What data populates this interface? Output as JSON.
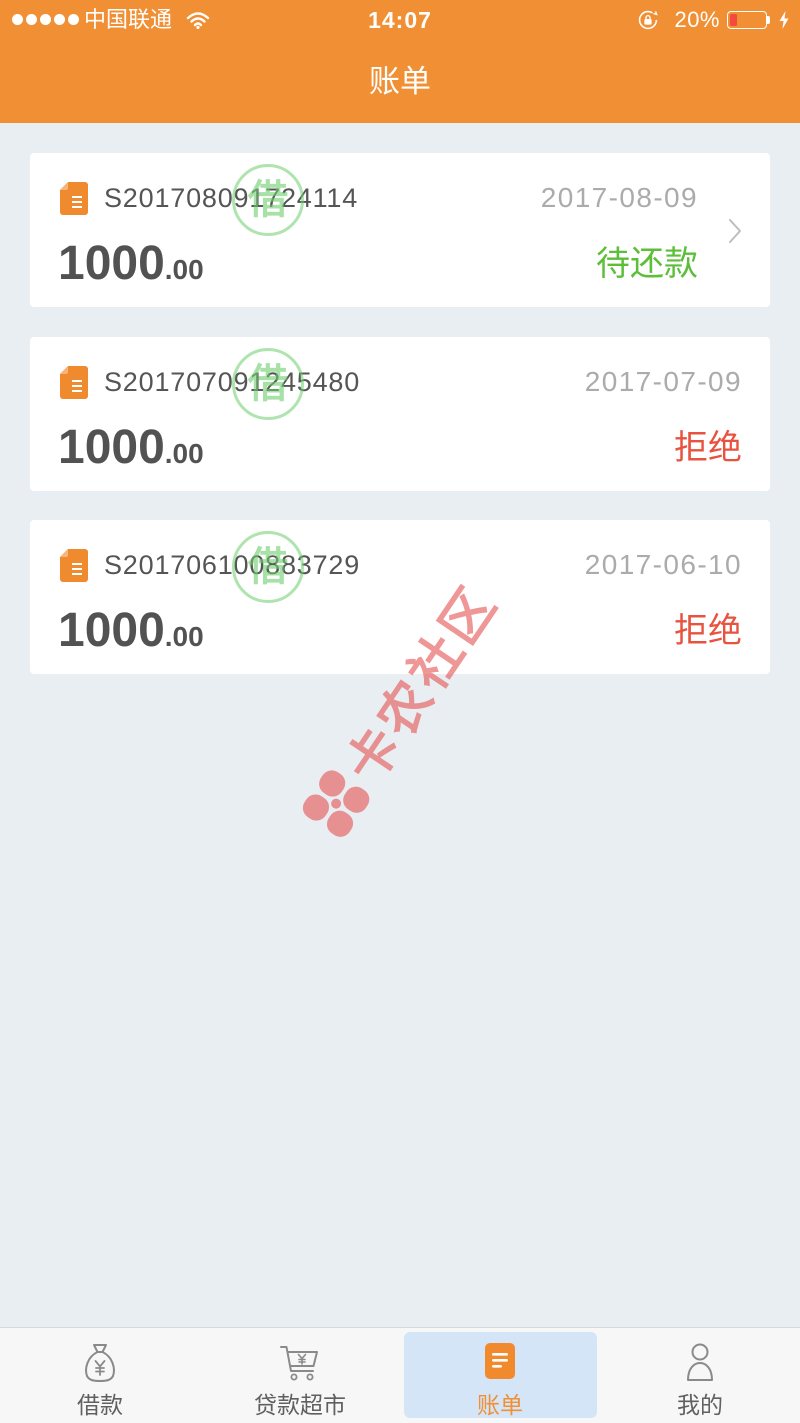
{
  "colors": {
    "brand": "#F18F34",
    "page_background": "#E9EEF2",
    "status_pending": "#5DBE39",
    "status_rejected": "#E8533F",
    "battery_fill": "#F24A3D",
    "tab_active_highlight": "#D4E5F8"
  },
  "status_bar": {
    "carrier": "中国联通",
    "time": "14:07",
    "battery_text": "20%",
    "battery_level": 0.2,
    "icons": [
      "signal-icon",
      "wifi-icon",
      "rotation-lock-icon",
      "battery-icon",
      "charging-bolt-icon"
    ]
  },
  "header": {
    "title": "账单"
  },
  "bills": [
    {
      "order_no": "S201708091724114",
      "date": "2017-08-09",
      "amount_integer": "1000",
      "amount_decimal": ".00",
      "status": "待还款",
      "status_color": "#5DBE39"
    },
    {
      "order_no": "S201707091245480",
      "date": "2017-07-09",
      "amount_integer": "1000",
      "amount_decimal": ".00",
      "status": "拒绝",
      "status_color": "#E8533F"
    },
    {
      "order_no": "S201706100883729",
      "date": "2017-06-10",
      "amount_integer": "1000",
      "amount_decimal": ".00",
      "status": "拒绝",
      "status_color": "#E8533F"
    }
  ],
  "stamp": {
    "text": "借"
  },
  "watermark": {
    "text": "卡农社区",
    "icon": "kanong-logo-icon"
  },
  "tabbar": {
    "items": [
      {
        "label": "借款",
        "icon": "money-bag-icon"
      },
      {
        "label": "贷款超市",
        "icon": "shopping-cart-icon"
      },
      {
        "label": "账单",
        "icon": "bill-icon",
        "active": true
      },
      {
        "label": "我的",
        "icon": "person-icon"
      }
    ]
  }
}
